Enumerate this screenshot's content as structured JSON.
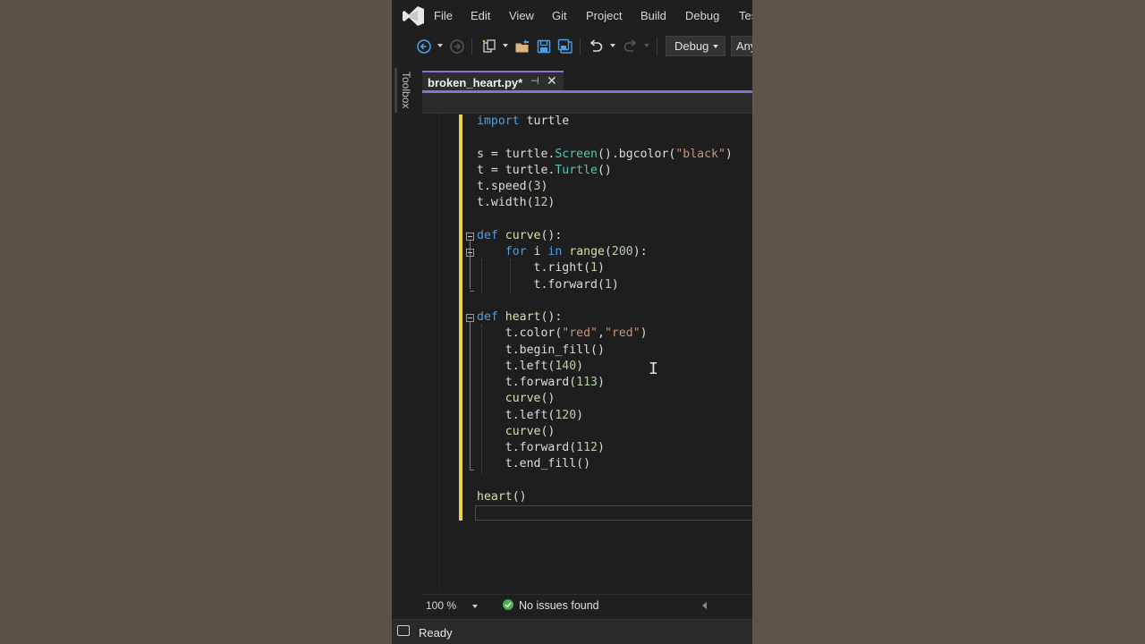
{
  "menu": {
    "items": [
      "File",
      "Edit",
      "View",
      "Git",
      "Project",
      "Build",
      "Debug",
      "Tes"
    ]
  },
  "toolbar": {
    "configuration": "Debug",
    "platform": "Any"
  },
  "toolbox": {
    "label": "Toolbox"
  },
  "tab": {
    "title": "broken_heart.py*"
  },
  "code": {
    "language": "python",
    "lines": [
      [
        {
          "t": "import",
          "c": "kw"
        },
        {
          "t": " turtle",
          "c": "id"
        }
      ],
      [],
      [
        {
          "t": "s = turtle.",
          "c": "id"
        },
        {
          "t": "Screen",
          "c": "cls"
        },
        {
          "t": "().bgcolor(",
          "c": "id"
        },
        {
          "t": "\"black\"",
          "c": "str"
        },
        {
          "t": ")",
          "c": "id"
        }
      ],
      [
        {
          "t": "t = turtle.",
          "c": "id"
        },
        {
          "t": "Turtle",
          "c": "cls"
        },
        {
          "t": "()",
          "c": "id"
        }
      ],
      [
        {
          "t": "t.speed(",
          "c": "id"
        },
        {
          "t": "3",
          "c": "num"
        },
        {
          "t": ")",
          "c": "id"
        }
      ],
      [
        {
          "t": "t.width(",
          "c": "id"
        },
        {
          "t": "12",
          "c": "num"
        },
        {
          "t": ")",
          "c": "id"
        }
      ],
      [],
      [
        {
          "t": "def",
          "c": "kw"
        },
        {
          "t": " ",
          "c": "id"
        },
        {
          "t": "curve",
          "c": "fn"
        },
        {
          "t": "():",
          "c": "id"
        }
      ],
      [
        {
          "t": "    ",
          "c": "id"
        },
        {
          "t": "for",
          "c": "kw"
        },
        {
          "t": " i ",
          "c": "id"
        },
        {
          "t": "in",
          "c": "kw"
        },
        {
          "t": " ",
          "c": "id"
        },
        {
          "t": "range",
          "c": "fn"
        },
        {
          "t": "(",
          "c": "id"
        },
        {
          "t": "200",
          "c": "num"
        },
        {
          "t": "):",
          "c": "id"
        }
      ],
      [
        {
          "t": "        t.right(",
          "c": "id"
        },
        {
          "t": "1",
          "c": "num"
        },
        {
          "t": ")",
          "c": "id"
        }
      ],
      [
        {
          "t": "        t.forward(",
          "c": "id"
        },
        {
          "t": "1",
          "c": "num"
        },
        {
          "t": ")",
          "c": "id"
        }
      ],
      [],
      [
        {
          "t": "def",
          "c": "kw"
        },
        {
          "t": " ",
          "c": "id"
        },
        {
          "t": "heart",
          "c": "fn"
        },
        {
          "t": "():",
          "c": "id"
        }
      ],
      [
        {
          "t": "    t.color(",
          "c": "id"
        },
        {
          "t": "\"red\"",
          "c": "str"
        },
        {
          "t": ",",
          "c": "id"
        },
        {
          "t": "\"red\"",
          "c": "str"
        },
        {
          "t": ")",
          "c": "id"
        }
      ],
      [
        {
          "t": "    t.begin_fill()",
          "c": "id"
        }
      ],
      [
        {
          "t": "    t.left(",
          "c": "id"
        },
        {
          "t": "140",
          "c": "num"
        },
        {
          "t": ")",
          "c": "id"
        }
      ],
      [
        {
          "t": "    t.forward(",
          "c": "id"
        },
        {
          "t": "113",
          "c": "num"
        },
        {
          "t": ")",
          "c": "id"
        }
      ],
      [
        {
          "t": "    ",
          "c": "id"
        },
        {
          "t": "curve",
          "c": "fn"
        },
        {
          "t": "()",
          "c": "id"
        }
      ],
      [
        {
          "t": "    t.left(",
          "c": "id"
        },
        {
          "t": "120",
          "c": "num"
        },
        {
          "t": ")",
          "c": "id"
        }
      ],
      [
        {
          "t": "    ",
          "c": "id"
        },
        {
          "t": "curve",
          "c": "fn"
        },
        {
          "t": "()",
          "c": "id"
        }
      ],
      [
        {
          "t": "    t.forward(",
          "c": "id"
        },
        {
          "t": "112",
          "c": "num"
        },
        {
          "t": ")",
          "c": "id"
        }
      ],
      [
        {
          "t": "    t.end_fill()",
          "c": "id"
        }
      ],
      [],
      [
        {
          "t": "heart",
          "c": "fn"
        },
        {
          "t": "()",
          "c": "id"
        }
      ],
      []
    ]
  },
  "editor_status": {
    "zoom": "100 %",
    "issues": "No issues found"
  },
  "status": {
    "text": "Ready"
  },
  "colors": {
    "accent": "#8f6cd8",
    "change_bar": "#e8d44d",
    "keyword": "#569cd6",
    "function": "#dcdcaa",
    "class": "#4ec9b0",
    "string": "#ce9178",
    "number": "#b5cea8"
  }
}
